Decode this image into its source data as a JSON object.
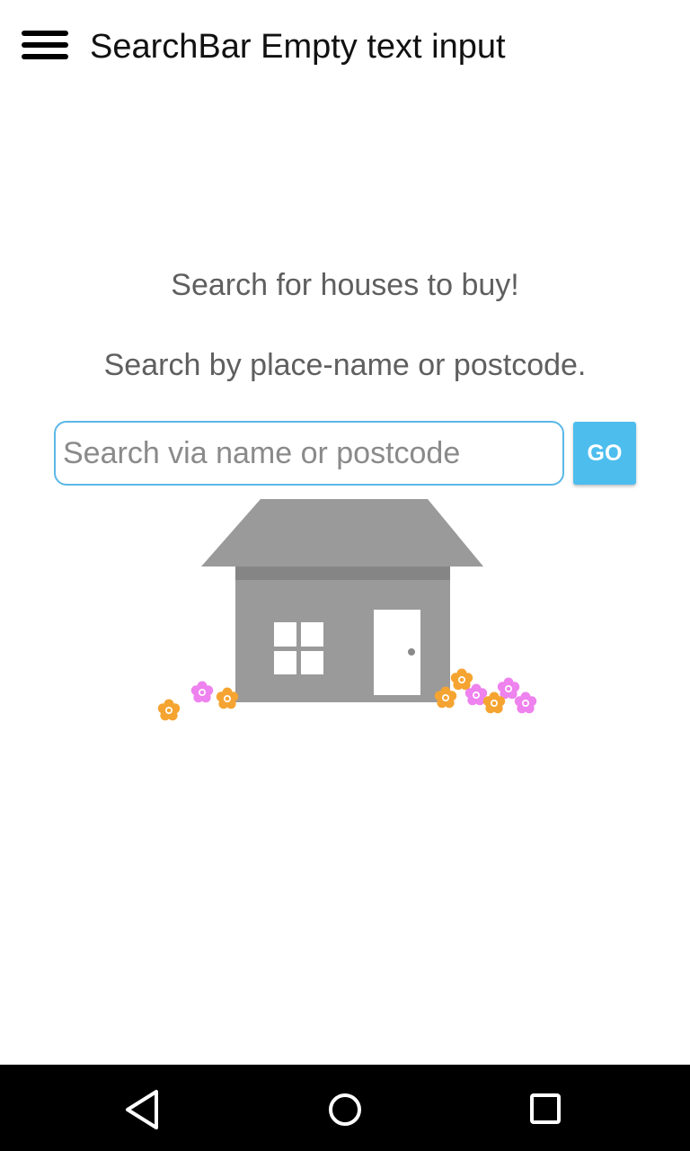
{
  "app_bar": {
    "title": "SearchBar Empty text input",
    "menu_icon": "hamburger-menu-icon"
  },
  "main": {
    "line1": "Search for houses to buy!",
    "line2": "Search by place-name or postcode.",
    "search": {
      "value": "",
      "placeholder": "Search via name or postcode"
    },
    "go_label": "GO"
  },
  "nav_bar": {
    "back_icon": "back-triangle-icon",
    "home_icon": "home-circle-icon",
    "recent_icon": "recent-apps-square-icon"
  },
  "colors": {
    "accent": "#4dbdee",
    "input_border": "#5ab8e6",
    "house_gray": "#9a9a9a",
    "flower_orange": "#f5a431",
    "flower_pink": "#ee82ee"
  }
}
